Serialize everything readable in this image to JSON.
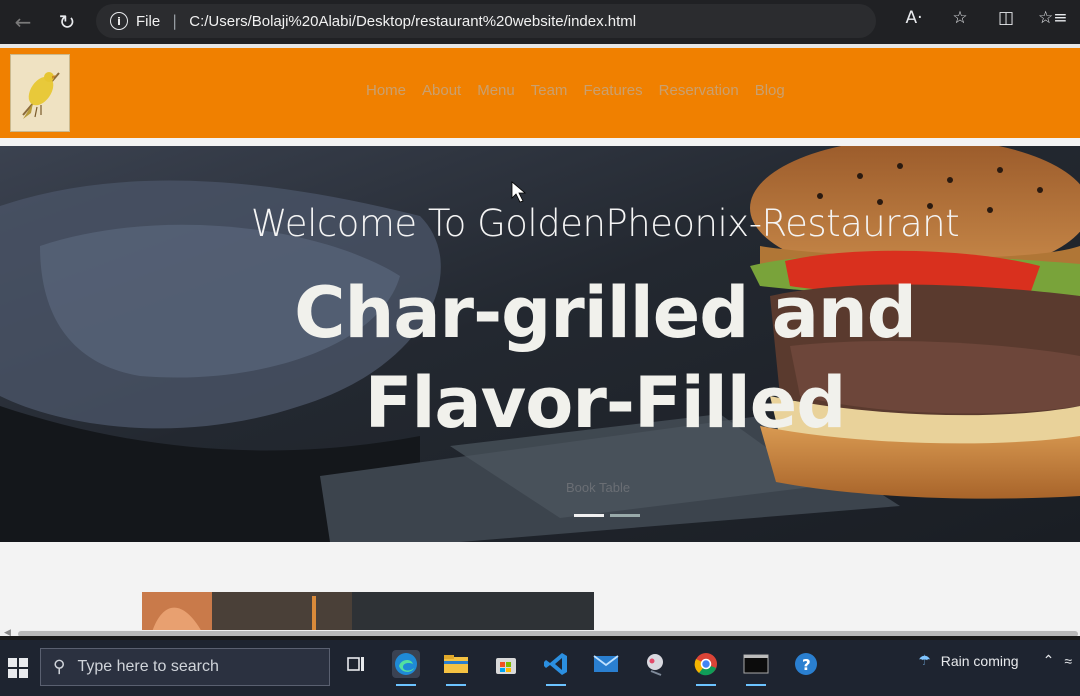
{
  "browser": {
    "address_scheme": "File",
    "address_url": "C:/Users/Bolaji%20Alabi/Desktop/restaurant%20website/index.html",
    "read_aloud_icon": "A·"
  },
  "site": {
    "nav": [
      "Home",
      "About",
      "Menu",
      "Team",
      "Features",
      "Reservation",
      "Blog"
    ],
    "hero_welcome": "Welcome To GoldenPheonix-Restaurant",
    "hero_title_line1": "Char-grilled and",
    "hero_title_line2": "Flavor-Filled",
    "book_button": "Book Table"
  },
  "taskbar": {
    "search_placeholder": "Type here to search",
    "weather": "Rain coming"
  },
  "colors": {
    "header_orange": "#f08000",
    "nav_text": "#c9a070",
    "taskbar": "#1e2430"
  }
}
